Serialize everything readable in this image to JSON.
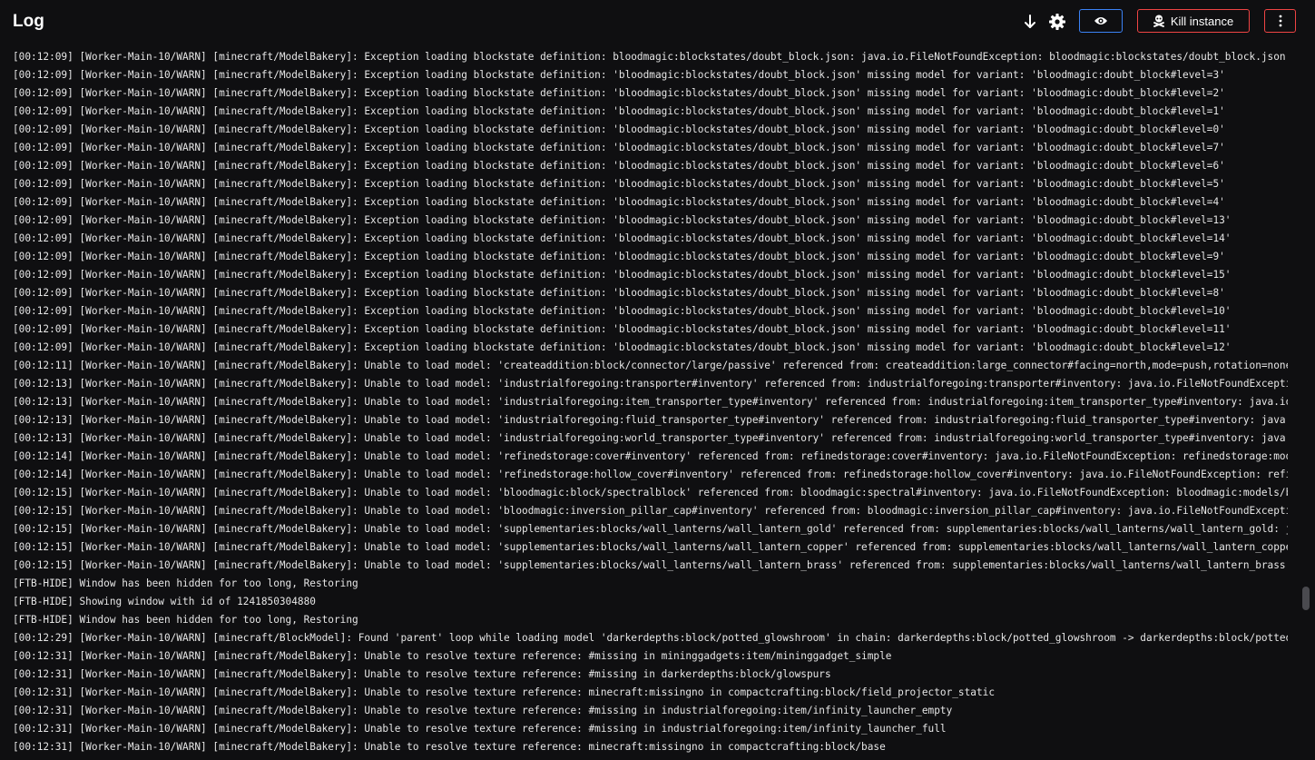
{
  "header": {
    "title": "Log",
    "icons": {
      "scroll_bottom": "arrow-down-icon",
      "settings": "gear-icon",
      "eye": "eye-icon",
      "kill": "skull-icon",
      "more": "vertical-dots-icon"
    },
    "kill_label": "Kill instance",
    "colors": {
      "eye_border": "#3b82f6",
      "kill_border": "#ef4444",
      "background": "#0f0f11",
      "text": "#e6e6e6"
    }
  },
  "log": {
    "lines": [
      "[00:12:09] [Worker-Main-10/WARN] [minecraft/ModelBakery]: Exception loading blockstate definition: bloodmagic:blockstates/doubt_block.json: java.io.FileNotFoundException: bloodmagic:blockstates/doubt_block.json",
      "[00:12:09] [Worker-Main-10/WARN] [minecraft/ModelBakery]: Exception loading blockstate definition: 'bloodmagic:blockstates/doubt_block.json' missing model for variant: 'bloodmagic:doubt_block#level=3'",
      "[00:12:09] [Worker-Main-10/WARN] [minecraft/ModelBakery]: Exception loading blockstate definition: 'bloodmagic:blockstates/doubt_block.json' missing model for variant: 'bloodmagic:doubt_block#level=2'",
      "[00:12:09] [Worker-Main-10/WARN] [minecraft/ModelBakery]: Exception loading blockstate definition: 'bloodmagic:blockstates/doubt_block.json' missing model for variant: 'bloodmagic:doubt_block#level=1'",
      "[00:12:09] [Worker-Main-10/WARN] [minecraft/ModelBakery]: Exception loading blockstate definition: 'bloodmagic:blockstates/doubt_block.json' missing model for variant: 'bloodmagic:doubt_block#level=0'",
      "[00:12:09] [Worker-Main-10/WARN] [minecraft/ModelBakery]: Exception loading blockstate definition: 'bloodmagic:blockstates/doubt_block.json' missing model for variant: 'bloodmagic:doubt_block#level=7'",
      "[00:12:09] [Worker-Main-10/WARN] [minecraft/ModelBakery]: Exception loading blockstate definition: 'bloodmagic:blockstates/doubt_block.json' missing model for variant: 'bloodmagic:doubt_block#level=6'",
      "[00:12:09] [Worker-Main-10/WARN] [minecraft/ModelBakery]: Exception loading blockstate definition: 'bloodmagic:blockstates/doubt_block.json' missing model for variant: 'bloodmagic:doubt_block#level=5'",
      "[00:12:09] [Worker-Main-10/WARN] [minecraft/ModelBakery]: Exception loading blockstate definition: 'bloodmagic:blockstates/doubt_block.json' missing model for variant: 'bloodmagic:doubt_block#level=4'",
      "[00:12:09] [Worker-Main-10/WARN] [minecraft/ModelBakery]: Exception loading blockstate definition: 'bloodmagic:blockstates/doubt_block.json' missing model for variant: 'bloodmagic:doubt_block#level=13'",
      "[00:12:09] [Worker-Main-10/WARN] [minecraft/ModelBakery]: Exception loading blockstate definition: 'bloodmagic:blockstates/doubt_block.json' missing model for variant: 'bloodmagic:doubt_block#level=14'",
      "[00:12:09] [Worker-Main-10/WARN] [minecraft/ModelBakery]: Exception loading blockstate definition: 'bloodmagic:blockstates/doubt_block.json' missing model for variant: 'bloodmagic:doubt_block#level=9'",
      "[00:12:09] [Worker-Main-10/WARN] [minecraft/ModelBakery]: Exception loading blockstate definition: 'bloodmagic:blockstates/doubt_block.json' missing model for variant: 'bloodmagic:doubt_block#level=15'",
      "[00:12:09] [Worker-Main-10/WARN] [minecraft/ModelBakery]: Exception loading blockstate definition: 'bloodmagic:blockstates/doubt_block.json' missing model for variant: 'bloodmagic:doubt_block#level=8'",
      "[00:12:09] [Worker-Main-10/WARN] [minecraft/ModelBakery]: Exception loading blockstate definition: 'bloodmagic:blockstates/doubt_block.json' missing model for variant: 'bloodmagic:doubt_block#level=10'",
      "[00:12:09] [Worker-Main-10/WARN] [minecraft/ModelBakery]: Exception loading blockstate definition: 'bloodmagic:blockstates/doubt_block.json' missing model for variant: 'bloodmagic:doubt_block#level=11'",
      "[00:12:09] [Worker-Main-10/WARN] [minecraft/ModelBakery]: Exception loading blockstate definition: 'bloodmagic:blockstates/doubt_block.json' missing model for variant: 'bloodmagic:doubt_block#level=12'",
      "[00:12:11] [Worker-Main-10/WARN] [minecraft/ModelBakery]: Unable to load model: 'createaddition:block/connector/large/passive' referenced from: createaddition:large_connector#facing=north,mode=push,rotation=none: j",
      "[00:12:13] [Worker-Main-10/WARN] [minecraft/ModelBakery]: Unable to load model: 'industrialforegoing:transporter#inventory' referenced from: industrialforegoing:transporter#inventory: java.io.FileNotFoundException",
      "[00:12:13] [Worker-Main-10/WARN] [minecraft/ModelBakery]: Unable to load model: 'industrialforegoing:item_transporter_type#inventory' referenced from: industrialforegoing:item_transporter_type#inventory: java.io.F",
      "[00:12:13] [Worker-Main-10/WARN] [minecraft/ModelBakery]: Unable to load model: 'industrialforegoing:fluid_transporter_type#inventory' referenced from: industrialforegoing:fluid_transporter_type#inventory: java.io",
      "[00:12:13] [Worker-Main-10/WARN] [minecraft/ModelBakery]: Unable to load model: 'industrialforegoing:world_transporter_type#inventory' referenced from: industrialforegoing:world_transporter_type#inventory: java.io",
      "[00:12:14] [Worker-Main-10/WARN] [minecraft/ModelBakery]: Unable to load model: 'refinedstorage:cover#inventory' referenced from: refinedstorage:cover#inventory: java.io.FileNotFoundException: refinedstorage:model",
      "[00:12:14] [Worker-Main-10/WARN] [minecraft/ModelBakery]: Unable to load model: 'refinedstorage:hollow_cover#inventory' referenced from: refinedstorage:hollow_cover#inventory: java.io.FileNotFoundException: refine",
      "[00:12:15] [Worker-Main-10/WARN] [minecraft/ModelBakery]: Unable to load model: 'bloodmagic:block/spectralblock' referenced from: bloodmagic:spectral#inventory: java.io.FileNotFoundException: bloodmagic:models/blo",
      "[00:12:15] [Worker-Main-10/WARN] [minecraft/ModelBakery]: Unable to load model: 'bloodmagic:inversion_pillar_cap#inventory' referenced from: bloodmagic:inversion_pillar_cap#inventory: java.io.FileNotFoundException",
      "[00:12:15] [Worker-Main-10/WARN] [minecraft/ModelBakery]: Unable to load model: 'supplementaries:blocks/wall_lanterns/wall_lantern_gold' referenced from: supplementaries:blocks/wall_lanterns/wall_lantern_gold: jav",
      "[00:12:15] [Worker-Main-10/WARN] [minecraft/ModelBakery]: Unable to load model: 'supplementaries:blocks/wall_lanterns/wall_lantern_copper' referenced from: supplementaries:blocks/wall_lanterns/wall_lantern_copper:",
      "[00:12:15] [Worker-Main-10/WARN] [minecraft/ModelBakery]: Unable to load model: 'supplementaries:blocks/wall_lanterns/wall_lantern_brass' referenced from: supplementaries:blocks/wall_lanterns/wall_lantern_brass: j",
      "[FTB-HIDE] Window has been hidden for too long, Restoring",
      "[FTB-HIDE] Showing window with id of 1241850304880",
      "[FTB-HIDE] Window has been hidden for too long, Restoring",
      "[00:12:29] [Worker-Main-10/WARN] [minecraft/BlockModel]: Found 'parent' loop while loading model 'darkerdepths:block/potted_glowshroom' in chain: darkerdepths:block/potted_glowshroom -> darkerdepths:block/potted_g",
      "[00:12:31] [Worker-Main-10/WARN] [minecraft/ModelBakery]: Unable to resolve texture reference: #missing in mininggadgets:item/mininggadget_simple",
      "[00:12:31] [Worker-Main-10/WARN] [minecraft/ModelBakery]: Unable to resolve texture reference: #missing in darkerdepths:block/glowspurs",
      "[00:12:31] [Worker-Main-10/WARN] [minecraft/ModelBakery]: Unable to resolve texture reference: minecraft:missingno in compactcrafting:block/field_projector_static",
      "[00:12:31] [Worker-Main-10/WARN] [minecraft/ModelBakery]: Unable to resolve texture reference: #missing in industrialforegoing:item/infinity_launcher_empty",
      "[00:12:31] [Worker-Main-10/WARN] [minecraft/ModelBakery]: Unable to resolve texture reference: #missing in industrialforegoing:item/infinity_launcher_full",
      "[00:12:31] [Worker-Main-10/WARN] [minecraft/ModelBakery]: Unable to resolve texture reference: minecraft:missingno in compactcrafting:block/base"
    ]
  }
}
